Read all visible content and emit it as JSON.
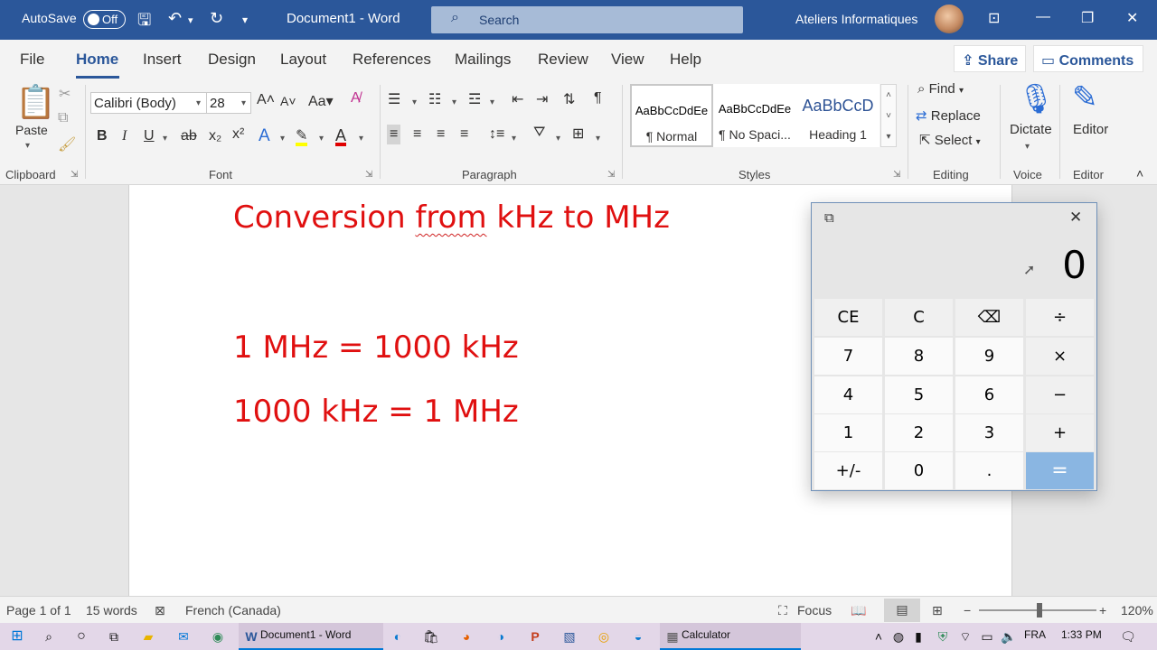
{
  "titlebar": {
    "autosave_label": "AutoSave",
    "autosave_state": "Off",
    "doc_title": "Document1  -  Word",
    "search_placeholder": "Search",
    "user_name": "Ateliers Informatiques"
  },
  "tabs": [
    "File",
    "Home",
    "Insert",
    "Design",
    "Layout",
    "References",
    "Mailings",
    "Review",
    "View",
    "Help"
  ],
  "share_label": "Share",
  "comments_label": "Comments",
  "ribbon": {
    "paste_label": "Paste",
    "font_name": "Calibri (Body)",
    "font_size": "28",
    "group_labels": {
      "clipboard": "Clipboard",
      "font": "Font",
      "paragraph": "Paragraph",
      "styles": "Styles",
      "editing": "Editing",
      "voice": "Voice",
      "editor": "Editor"
    },
    "styles": [
      {
        "sample": "AaBbCcDdEe",
        "name": "¶ Normal"
      },
      {
        "sample": "AaBbCcDdEe",
        "name": "¶ No Spaci..."
      },
      {
        "sample": "AaBbCcD",
        "name": "Heading 1"
      }
    ],
    "editing": {
      "find": "Find",
      "replace": "Replace",
      "select": "Select"
    },
    "dictate_label": "Dictate",
    "editor_label": "Editor"
  },
  "document": {
    "line1_pre": "Conversion ",
    "line1_squiggle": "from",
    "line1_post": " kHz to MHz",
    "line2": "1 MHz = 1000 kHz",
    "line3": "1000 kHz = 1 MHz"
  },
  "calculator": {
    "display": "0",
    "keys": [
      "CE",
      "C",
      "⌫",
      "÷",
      "7",
      "8",
      "9",
      "×",
      "4",
      "5",
      "6",
      "−",
      "1",
      "2",
      "3",
      "+",
      "+/-",
      "0",
      ".",
      "="
    ]
  },
  "statusbar": {
    "page": "Page 1 of 1",
    "words": "15 words",
    "language": "French (Canada)",
    "focus": "Focus",
    "zoom": "120%"
  },
  "taskbar": {
    "word_app": "Document1 - Word",
    "calc_app": "Calculator",
    "lang": "FRA",
    "time": "1:33 PM"
  },
  "colors": {
    "word_blue": "#2b579a",
    "doc_text_red": "#e01010",
    "calc_equals": "#8ab6e2"
  }
}
